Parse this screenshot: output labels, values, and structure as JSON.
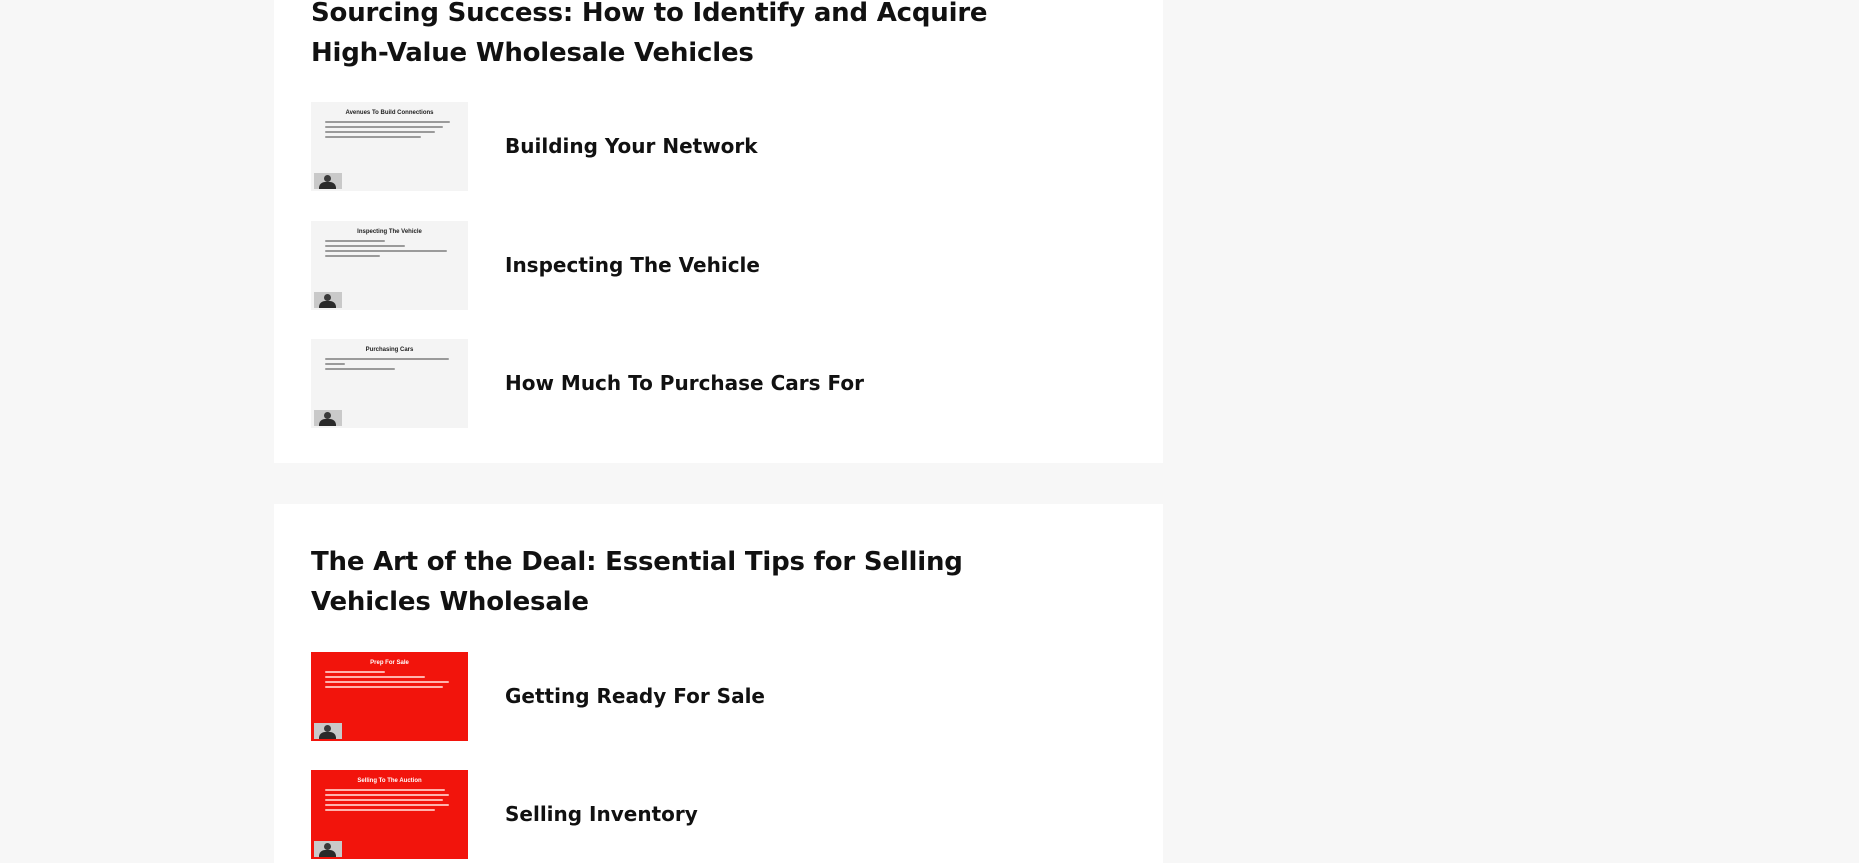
{
  "modules": [
    {
      "title": "Sourcing Success: How to Identify and Acquire High-Value Wholesale Vehicles",
      "lessons": [
        {
          "title": "Building Your Network",
          "thumb_title": "Avenues To Build Connections",
          "thumb_style": "light"
        },
        {
          "title": "Inspecting The Vehicle",
          "thumb_title": "Inspecting The Vehicle",
          "thumb_style": "light"
        },
        {
          "title": "How Much To Purchase Cars For",
          "thumb_title": "Purchasing Cars",
          "thumb_style": "light"
        }
      ]
    },
    {
      "title": "The Art of the Deal: Essential Tips for Selling Vehicles Wholesale",
      "lessons": [
        {
          "title": "Getting Ready For Sale",
          "thumb_title": "Prep For Sale",
          "thumb_style": "red"
        },
        {
          "title": "Selling Inventory",
          "thumb_title": "Selling To The Auction",
          "thumb_style": "red"
        }
      ]
    }
  ],
  "colors": {
    "page_background": "#f7f7f7",
    "card_background": "#ffffff",
    "thumbnail_red": "#f2140c",
    "thumbnail_light": "#f4f4f4",
    "text": "#111111"
  }
}
